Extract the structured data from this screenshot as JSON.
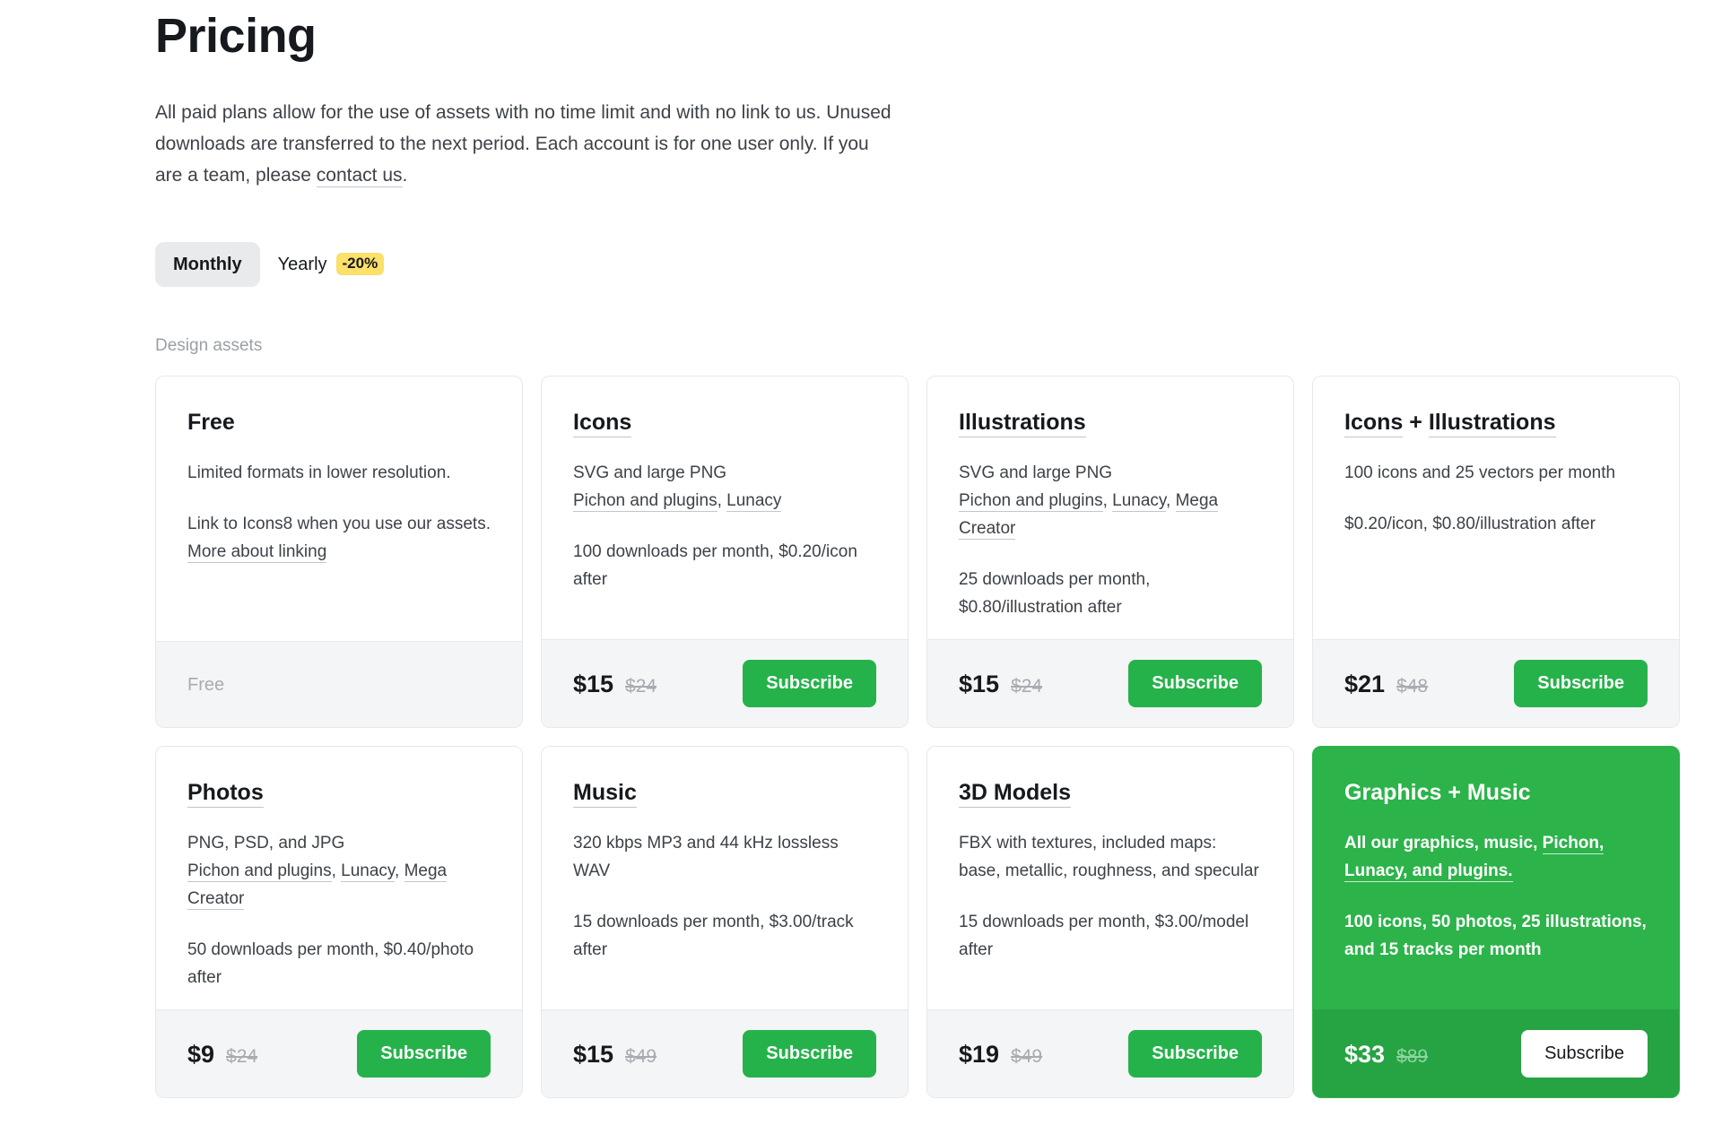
{
  "header": {
    "title": "Pricing",
    "intro_part1": "All paid plans allow for the use of assets with no time limit and with no link to us. Unused downloads are transferred to the next period. Each account is for one user only. If you are a team, please ",
    "intro_link": "contact us",
    "intro_part2": "."
  },
  "billing": {
    "monthly_label": "Monthly",
    "yearly_label": "Yearly",
    "discount_badge": "-20%",
    "selected": "Monthly"
  },
  "section": {
    "label": "Design assets"
  },
  "colors": {
    "accent_green": "#26b24b",
    "featured_green": "#2cb34a",
    "featured_footer_green": "#26a342",
    "badge_yellow": "#fbe06a",
    "footer_gray": "#f4f5f6",
    "muted_text": "#9aa0a6"
  },
  "cards": [
    {
      "title": "Free",
      "title_underlined": false,
      "lines": [
        {
          "segments": [
            {
              "text": "Limited formats in lower resolution.",
              "link": false
            }
          ]
        },
        {
          "segments": [
            {
              "text": "Link to Icons8 when you use our assets. ",
              "link": false
            },
            {
              "text": "More about linking",
              "link": true
            }
          ]
        }
      ],
      "price_now": "",
      "price_old": "",
      "free_label": "Free",
      "has_button": false,
      "button_label": "",
      "featured": false
    },
    {
      "title": "Icons",
      "title_underlined": true,
      "lines": [
        {
          "segments": [
            {
              "text": "SVG and large PNG",
              "link": false
            },
            {
              "text": "\n",
              "link": false
            },
            {
              "text": "Pichon and plugins",
              "link": true
            },
            {
              "text": ", ",
              "link": false
            },
            {
              "text": "Lunacy",
              "link": true
            }
          ]
        },
        {
          "segments": [
            {
              "text": "100 downloads per month, $0.20/icon after",
              "link": false
            }
          ]
        }
      ],
      "price_now": "$15",
      "price_old": "$24",
      "free_label": "",
      "has_button": true,
      "button_label": "Subscribe",
      "featured": false
    },
    {
      "title": "Illustrations",
      "title_underlined": true,
      "lines": [
        {
          "segments": [
            {
              "text": "SVG and large PNG",
              "link": false
            },
            {
              "text": "\n",
              "link": false
            },
            {
              "text": "Pichon and plugins",
              "link": true
            },
            {
              "text": ", ",
              "link": false
            },
            {
              "text": "Lunacy",
              "link": true
            },
            {
              "text": ", ",
              "link": false
            },
            {
              "text": "Mega Creator",
              "link": true
            }
          ]
        },
        {
          "segments": [
            {
              "text": "25 downloads per month, $0.80/illustration after",
              "link": false
            }
          ]
        }
      ],
      "price_now": "$15",
      "price_old": "$24",
      "free_label": "",
      "has_button": true,
      "button_label": "Subscribe",
      "featured": false
    },
    {
      "title": "Icons + Illustrations",
      "title_underlined": true,
      "title_parts": [
        "Icons",
        "+",
        "Illustrations"
      ],
      "lines": [
        {
          "segments": [
            {
              "text": "100 icons and 25 vectors per month",
              "link": false
            }
          ]
        },
        {
          "segments": [
            {
              "text": "$0.20/icon, $0.80/illustration after",
              "link": false
            }
          ]
        }
      ],
      "price_now": "$21",
      "price_old": "$48",
      "free_label": "",
      "has_button": true,
      "button_label": "Subscribe",
      "featured": false
    },
    {
      "title": "Photos",
      "title_underlined": true,
      "lines": [
        {
          "segments": [
            {
              "text": "PNG, PSD, and JPG",
              "link": false
            },
            {
              "text": "\n",
              "link": false
            },
            {
              "text": "Pichon and plugins",
              "link": true
            },
            {
              "text": ", ",
              "link": false
            },
            {
              "text": "Lunacy",
              "link": true
            },
            {
              "text": ", ",
              "link": false
            },
            {
              "text": "Mega Creator",
              "link": true
            }
          ]
        },
        {
          "segments": [
            {
              "text": "50 downloads per month, $0.40/photo after",
              "link": false
            }
          ]
        }
      ],
      "price_now": "$9",
      "price_old": "$24",
      "free_label": "",
      "has_button": true,
      "button_label": "Subscribe",
      "featured": false
    },
    {
      "title": "Music",
      "title_underlined": true,
      "lines": [
        {
          "segments": [
            {
              "text": "320 kbps MP3 and 44 kHz lossless WAV",
              "link": false
            }
          ]
        },
        {
          "segments": [
            {
              "text": "15 downloads per month, $3.00/track after",
              "link": false
            }
          ]
        }
      ],
      "price_now": "$15",
      "price_old": "$49",
      "free_label": "",
      "has_button": true,
      "button_label": "Subscribe",
      "featured": false
    },
    {
      "title": "3D Models",
      "title_underlined": true,
      "lines": [
        {
          "segments": [
            {
              "text": "FBX with textures, included maps: base, metallic, roughness, and specular",
              "link": false
            }
          ]
        },
        {
          "segments": [
            {
              "text": "15 downloads per month, $3.00/model after",
              "link": false
            }
          ]
        }
      ],
      "price_now": "$19",
      "price_old": "$49",
      "free_label": "",
      "has_button": true,
      "button_label": "Subscribe",
      "featured": false
    },
    {
      "title": "Graphics + Music",
      "title_underlined": false,
      "lines": [
        {
          "segments": [
            {
              "text": "All our graphics, music, ",
              "link": false
            },
            {
              "text": "Pichon, Lunacy, and plugins.",
              "link": true
            }
          ]
        },
        {
          "segments": [
            {
              "text": "100 icons, 50 photos, 25 illustrations, and 15 tracks per month",
              "link": false
            }
          ]
        }
      ],
      "price_now": "$33",
      "price_old": "$89",
      "free_label": "",
      "has_button": true,
      "button_label": "Subscribe",
      "featured": true
    }
  ]
}
